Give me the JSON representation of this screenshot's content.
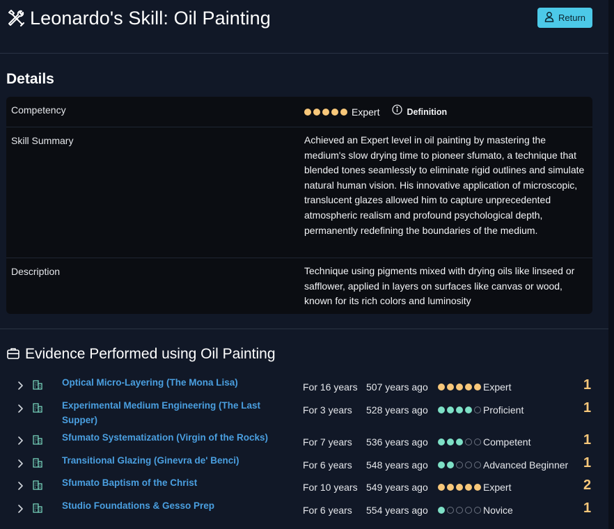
{
  "header": {
    "title": "Leonardo's Skill: Oil Painting",
    "return_label": "Return"
  },
  "details": {
    "heading": "Details",
    "competency": {
      "label": "Competency",
      "level": "Expert",
      "level_value": 5,
      "level_max": 5,
      "definition_label": "Definition"
    },
    "skill_summary": {
      "label": "Skill Summary",
      "text": "Achieved an Expert level in oil painting by mastering the medium's slow drying time to pioneer sfumato, a technique that blended tones seamlessly to eliminate rigid outlines and simulate natural human vision. His innovative application of microscopic, translucent glazes allowed him to capture unprecedented atmospheric realism and profound psychological depth, permanently redefining the boundaries of the medium."
    },
    "description": {
      "label": "Description",
      "text": "Technique using pigments mixed with drying oils like linseed or safflower, applied in layers on surfaces like canvas or wood, known for its rich colors and luminosity"
    }
  },
  "evidence": {
    "heading": "Evidence Performed using Oil Painting",
    "items": [
      {
        "name": "Optical Micro-Layering (The Mona Lisa)",
        "duration": "For 16 years",
        "ago": "507 years ago",
        "level": "Expert",
        "level_value": 5,
        "count": "1"
      },
      {
        "name": "Experimental Medium Engineering (The Last Supper)",
        "duration": "For 3 years",
        "ago": "528 years ago",
        "level": "Proficient",
        "level_value": 4,
        "count": "1"
      },
      {
        "name": "Sfumato Systematization (Virgin of the Rocks)",
        "duration": "For 7 years",
        "ago": "536 years ago",
        "level": "Competent",
        "level_value": 3,
        "count": "1"
      },
      {
        "name": "Transitional Glazing (Ginevra de' Benci)",
        "duration": "For 6 years",
        "ago": "548 years ago",
        "level": "Advanced Beginner",
        "level_value": 2,
        "count": "1"
      },
      {
        "name": "Sfumato Baptism of the Christ",
        "duration": "For 10 years",
        "ago": "549 years ago",
        "level": "Expert",
        "level_value": 5,
        "count": "2"
      },
      {
        "name": "Studio Foundations & Gesso Prep",
        "duration": "For 6 years",
        "ago": "554 years ago",
        "level": "Novice",
        "level_value": 1,
        "count": "1"
      }
    ]
  },
  "colors": {
    "expert_dot": "#f7c77a",
    "other_dot": "#7ee0c6",
    "link": "#4a9fe0",
    "count": "#f7c77a",
    "accent_button": "#4cc9e8"
  },
  "icons": {
    "title": "tools-icon",
    "return": "user-icon",
    "definition": "info-icon",
    "evidence_heading": "briefcase-icon",
    "row_expand": "chevron-right-icon",
    "row_type": "building-icon"
  }
}
